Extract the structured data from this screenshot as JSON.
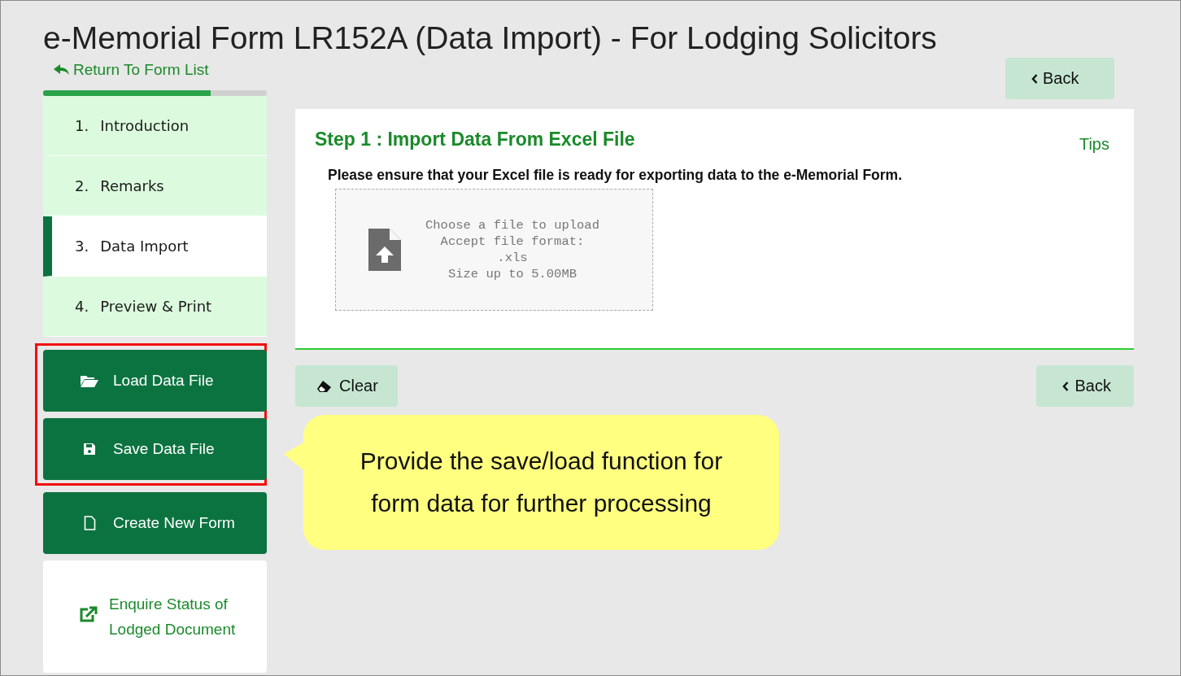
{
  "page": {
    "title": "e-Memorial Form LR152A (Data Import) - For Lodging Solicitors",
    "return_link": "Return To Form List"
  },
  "progress": {
    "level": 0.75
  },
  "steps": [
    {
      "number": "1.",
      "label": "Introduction",
      "selected": false
    },
    {
      "number": "2.",
      "label": "Remarks",
      "selected": false
    },
    {
      "number": "3.",
      "label": "Data Import",
      "selected": true
    },
    {
      "number": "4.",
      "label": "Preview & Print",
      "selected": false
    }
  ],
  "actions": [
    {
      "kind": "primary",
      "label": "Load Data File",
      "highlighted": true
    },
    {
      "kind": "primary",
      "label": "Save Data File",
      "highlighted": true
    },
    {
      "kind": "primary",
      "label": "Create New Form",
      "highlighted": false
    },
    {
      "kind": "link",
      "label": "Enquire Status of Lodged Document",
      "highlighted": false
    }
  ],
  "top_button": "Back",
  "panel": {
    "heading": "Step 1 : Import Data From Excel File",
    "tips": "Tips",
    "instruction": "Please ensure that your Excel file is ready for exporting data to the e-Memorial Form.",
    "upload": {
      "lines": [
        "Choose a file to upload",
        "Accept file format:",
        ".xls",
        "Size up to 5.00MB"
      ]
    }
  },
  "bottom_buttons": [
    {
      "kind": "clear",
      "label": "Clear"
    },
    {
      "kind": "back",
      "label": "Back"
    }
  ],
  "callout": {
    "text": "Provide the save/load function for form data for further processing"
  }
}
